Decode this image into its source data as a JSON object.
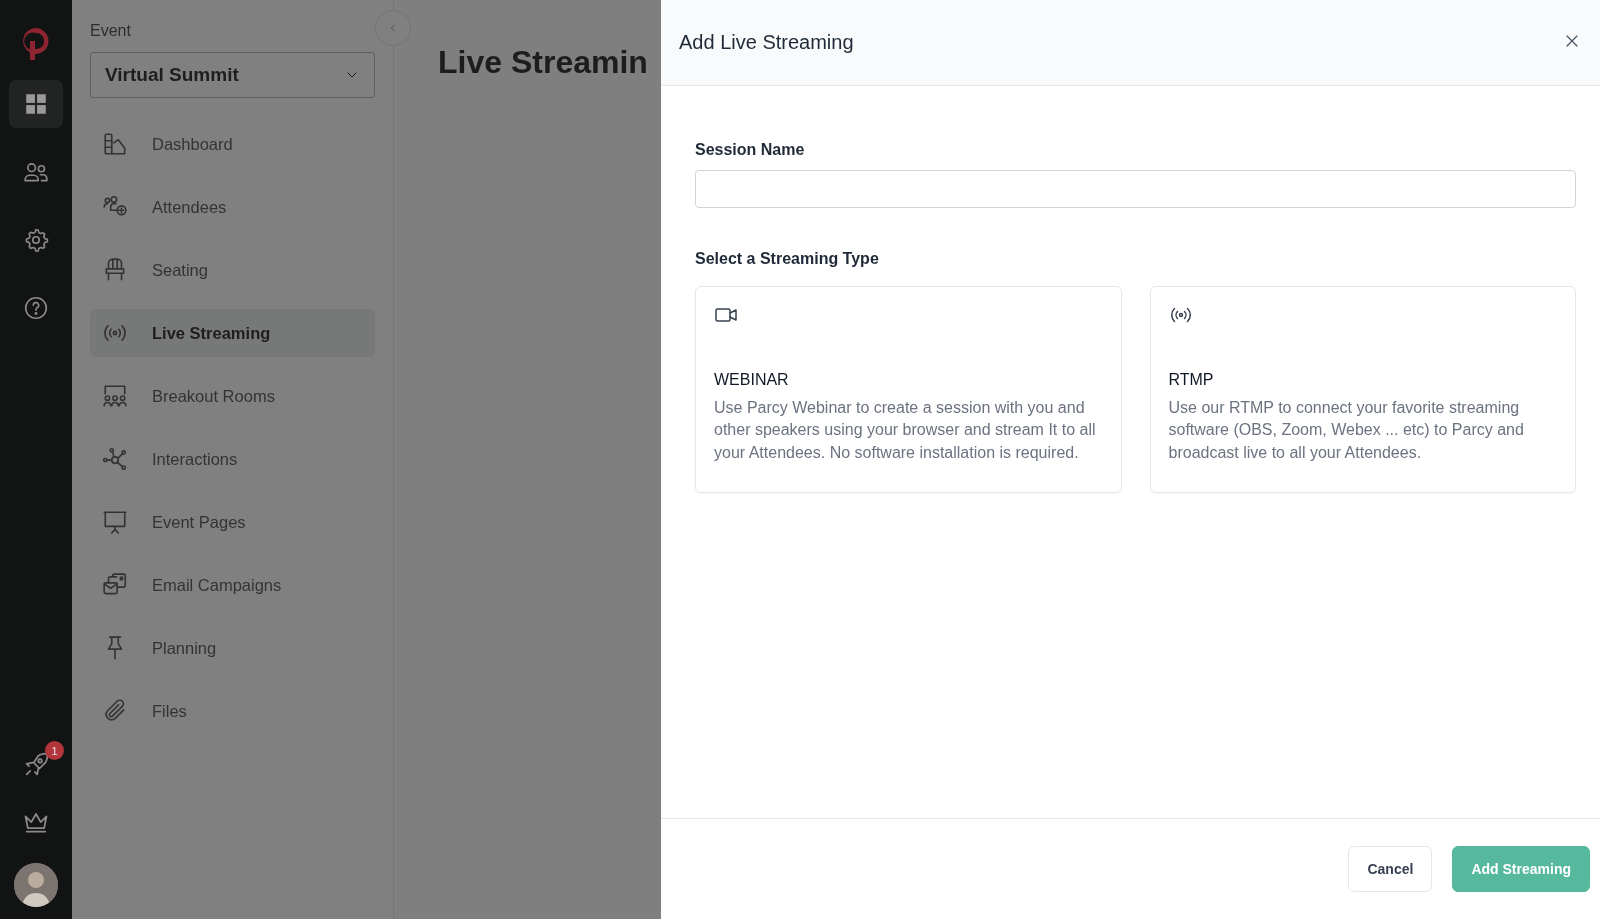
{
  "rail": {
    "items": [
      {
        "selected": true
      },
      {
        "selected": false
      },
      {
        "selected": false
      },
      {
        "selected": false
      }
    ],
    "badge": "1"
  },
  "sidebar": {
    "event_label": "Event",
    "event_select": {
      "value": "Virtual Summit"
    },
    "items": [
      {
        "label": "Dashboard",
        "selected": false
      },
      {
        "label": "Attendees",
        "selected": false
      },
      {
        "label": "Seating",
        "selected": false
      },
      {
        "label": "Live Streaming",
        "selected": true
      },
      {
        "label": "Breakout Rooms",
        "selected": false
      },
      {
        "label": "Interactions",
        "selected": false
      },
      {
        "label": "Event Pages",
        "selected": false
      },
      {
        "label": "Email Campaigns",
        "selected": false
      },
      {
        "label": "Planning",
        "selected": false
      },
      {
        "label": "Files",
        "selected": false
      }
    ]
  },
  "main": {
    "title": "Live Streamin"
  },
  "modal": {
    "title": "Add Live Streaming",
    "session_name": {
      "label": "Session Name"
    },
    "streaming_type_label": "Select a Streaming Type",
    "options": [
      {
        "title": "WEBINAR",
        "description": "Use Parcy Webinar to create a session with you and other speakers using your browser and stream It to all your Attendees. No software installation is required.",
        "selected": false
      },
      {
        "title": "RTMP",
        "description": "Use our RTMP to connect your favorite streaming software (OBS, Zoom, Webex ... etc) to Parcy and broadcast live to all your Attendees.",
        "selected": false
      }
    ],
    "buttons": [
      {
        "label": "Cancel",
        "kind": "secondary"
      },
      {
        "label": "Add Streaming",
        "kind": "primary"
      }
    ]
  }
}
